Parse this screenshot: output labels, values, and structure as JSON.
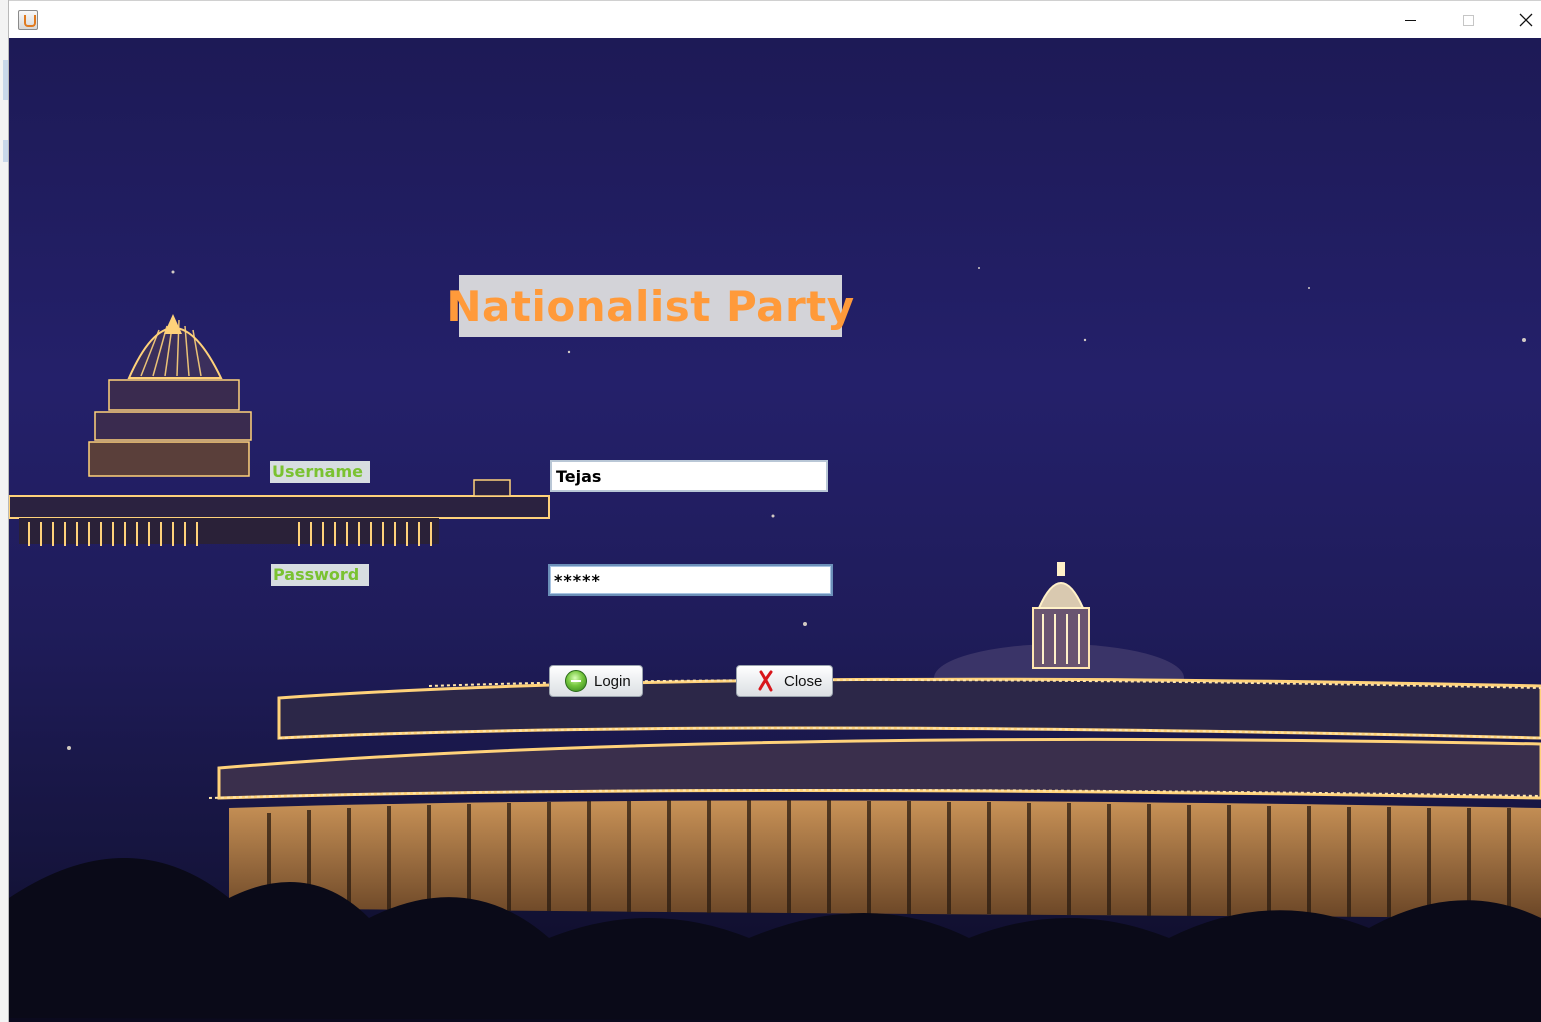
{
  "window": {
    "controls": {
      "minimize_icon": "minimize-icon",
      "maximize_icon": "maximize-icon",
      "close_icon": "close-icon"
    }
  },
  "app": {
    "title": "Nationalist Party"
  },
  "form": {
    "username_label": "Username",
    "username_value": "Tejas",
    "password_label": "Password",
    "password_value": "*****"
  },
  "buttons": {
    "login_label": "Login",
    "close_label": "Close"
  },
  "colors": {
    "title_text": "#ff9a3a",
    "label_text": "#7ac231",
    "night_sky": "#1f1c5a",
    "lights": "#ffd27a"
  }
}
